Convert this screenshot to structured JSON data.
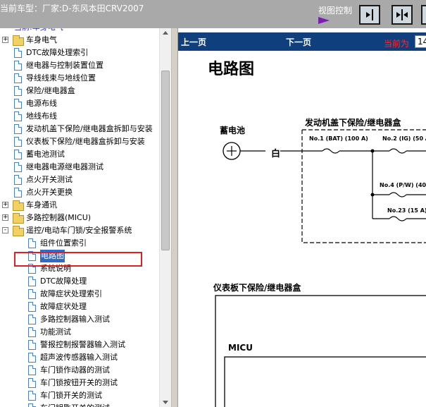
{
  "header": {
    "vehicle_label": "当前车型：厂家:D-东风本田CRV2007",
    "view_control_label": "视图控制"
  },
  "tree": {
    "partial_top_item": "当前:车身电气",
    "items": [
      {
        "label": "车身电气",
        "kind": "folder",
        "expander": "+"
      },
      {
        "label": "DTC故障处理索引",
        "kind": "page"
      },
      {
        "label": "继电器与控制装置位置",
        "kind": "page"
      },
      {
        "label": "导线线束与地线位置",
        "kind": "page"
      },
      {
        "label": "保险/继电器盒",
        "kind": "page"
      },
      {
        "label": "电源布线",
        "kind": "page"
      },
      {
        "label": "地线布线",
        "kind": "page"
      },
      {
        "label": "发动机盖下保险/继电器盒拆卸与安装",
        "kind": "page"
      },
      {
        "label": "仪表板下保险/继电器盒拆卸与安装",
        "kind": "page"
      },
      {
        "label": "蓄电池测试",
        "kind": "page"
      },
      {
        "label": "继电器电源继电器测试",
        "kind": "page"
      },
      {
        "label": "点火开关测试",
        "kind": "page"
      },
      {
        "label": "点火开关更换",
        "kind": "page"
      },
      {
        "label": "车身通讯",
        "kind": "folder",
        "expander": "+"
      },
      {
        "label": "多路控制器(MICU)",
        "kind": "folder",
        "expander": "+"
      },
      {
        "label": "遥控/电动车门锁/安全报警系统",
        "kind": "folder",
        "expander": "-"
      },
      {
        "label": "组件位置索引",
        "kind": "page",
        "indent": 1
      },
      {
        "label": "电路图",
        "kind": "page",
        "indent": 1,
        "selected": true
      },
      {
        "label": "系统说明",
        "kind": "page",
        "indent": 1
      },
      {
        "label": "DTC故障处理",
        "kind": "page",
        "indent": 1
      },
      {
        "label": "故障症状处理索引",
        "kind": "page",
        "indent": 1
      },
      {
        "label": "故障症状处理",
        "kind": "page",
        "indent": 1
      },
      {
        "label": "多路控制器输入测试",
        "kind": "page",
        "indent": 1
      },
      {
        "label": "功能测试",
        "kind": "page",
        "indent": 1
      },
      {
        "label": "警报控制报警器输入测试",
        "kind": "page",
        "indent": 1
      },
      {
        "label": "超声波传感器输入测试",
        "kind": "page",
        "indent": 1
      },
      {
        "label": "车门锁作动器的测试",
        "kind": "page",
        "indent": 1
      },
      {
        "label": "车门锁按钮开关的测试",
        "kind": "page",
        "indent": 1
      },
      {
        "label": "车门锁开关的测试",
        "kind": "page",
        "indent": 1
      },
      {
        "label": "车门钥匙开关的测试",
        "kind": "page",
        "indent": 1
      }
    ]
  },
  "nav": {
    "prev": "上一页",
    "next": "下一页",
    "current_label": "当前为",
    "current_page": "14"
  },
  "document": {
    "title": "电路图",
    "battery_label": "蓄电池",
    "wire_color": "白",
    "fuse_box_label": "发动机盖下保险/继电器盒",
    "fuse1": "No.1 (BAT) (100 A)",
    "fuse2": "No.2 (IG) (50 A",
    "fuse4": "No.4 (P/W) (40 A",
    "fuse23": "No.23 (15 A)",
    "dash_box_label": "仪表板下保险/继电器盒",
    "micu_label": "MICU"
  },
  "colors": {
    "topbar": "#a9a9a9",
    "navbar": "#103f7e",
    "selected": "#316ac5",
    "highlight": "#e02020",
    "folder": "#f3d063"
  }
}
